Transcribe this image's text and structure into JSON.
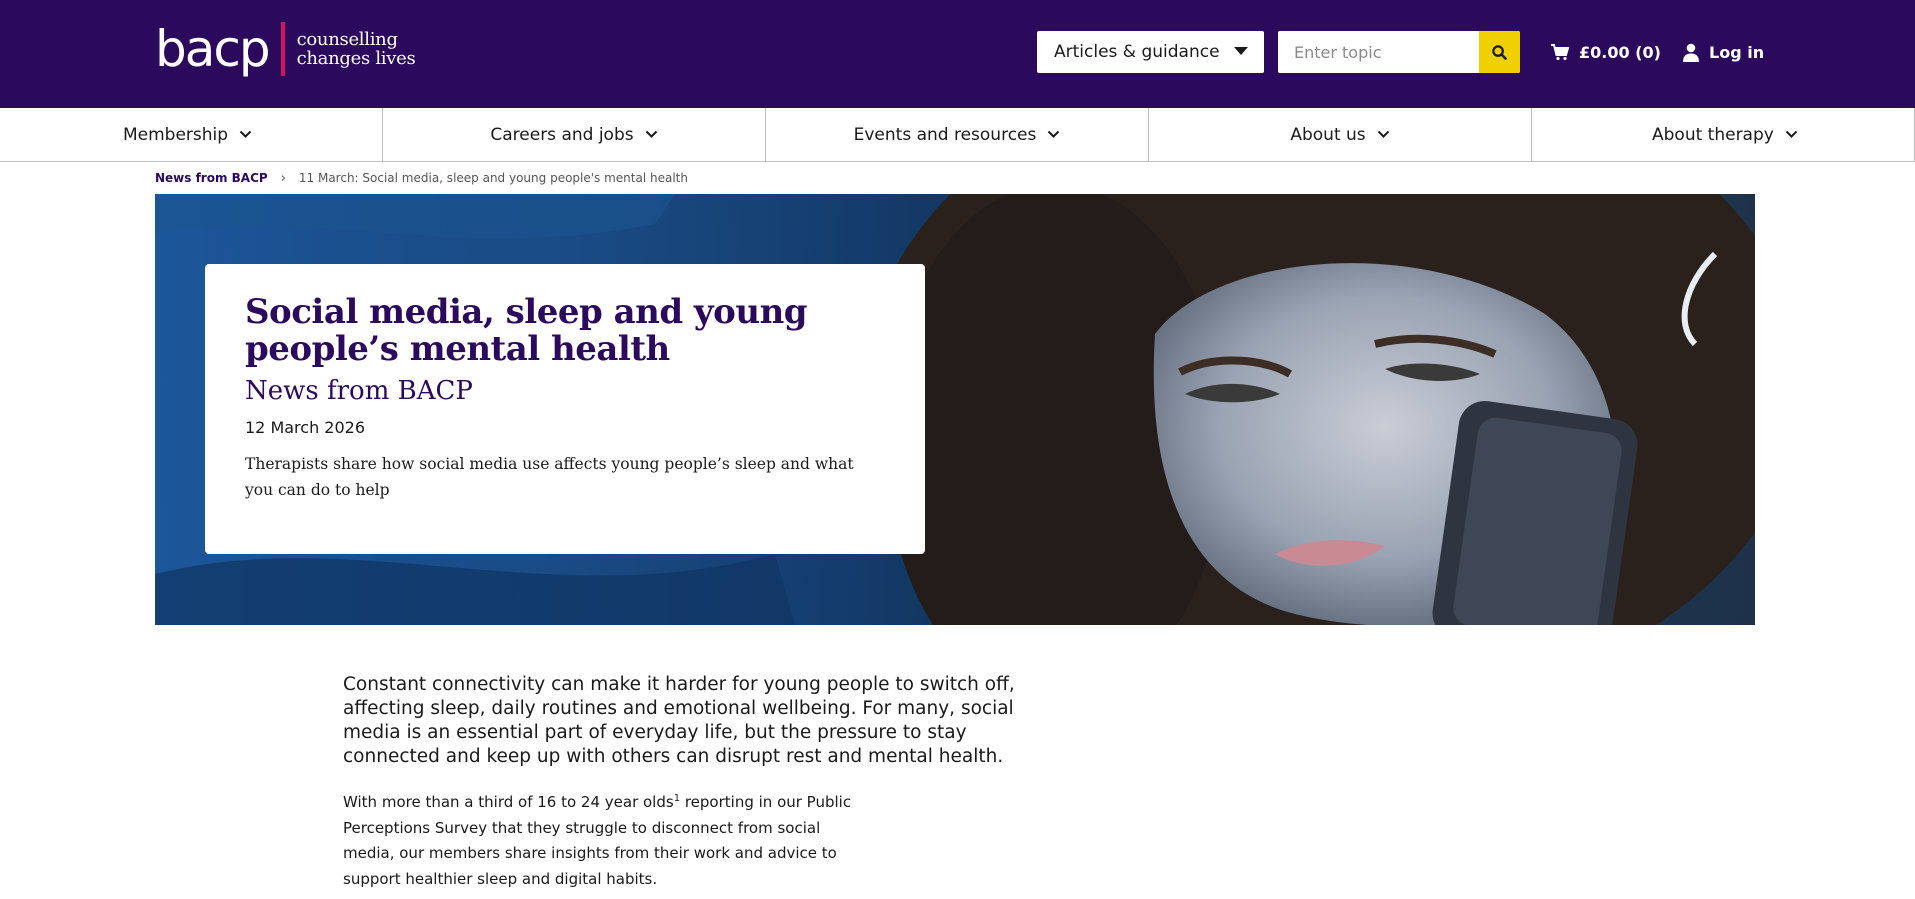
{
  "header": {
    "logo_word": "bacp",
    "logo_tagline_1": "counselling",
    "logo_tagline_2": "changes lives",
    "category_select": "Articles & guidance",
    "search_placeholder": "Enter topic",
    "basket": "£0.00 (0)",
    "login": "Log in",
    "colors": {
      "brand_purple": "#2b0a5e",
      "accent_yellow": "#f0d000",
      "logo_bar": "#d4145a"
    }
  },
  "nav": {
    "items": [
      {
        "label": "Membership"
      },
      {
        "label": "Careers and jobs"
      },
      {
        "label": "Events and resources"
      },
      {
        "label": "About us"
      },
      {
        "label": "About therapy"
      }
    ]
  },
  "breadcrumb": {
    "home": "News from BACP",
    "separator": "›",
    "current": "11 March: Social media, sleep and young people's mental health"
  },
  "hero": {
    "title": "Social media, sleep and young people’s mental health",
    "subtitle": "News from BACP",
    "date": "12 March 2026",
    "description": "Therapists share how social media use affects young people’s sleep and what you can do to help"
  },
  "article": {
    "intro": "Constant connectivity can make it harder for young people to switch off, affecting sleep, daily routines and emotional wellbeing. For many, social media is an essential part of everyday life, but the pressure to stay connected and keep up with others can disrupt rest and mental health.",
    "para_before": "With more than a third of 16 to 24 year olds",
    "para_footnote": "1",
    "para_after": " reporting in our Public Perceptions Survey that they struggle to disconnect from social media, our members share insights from their work and advice to support healthier sleep and digital habits."
  }
}
